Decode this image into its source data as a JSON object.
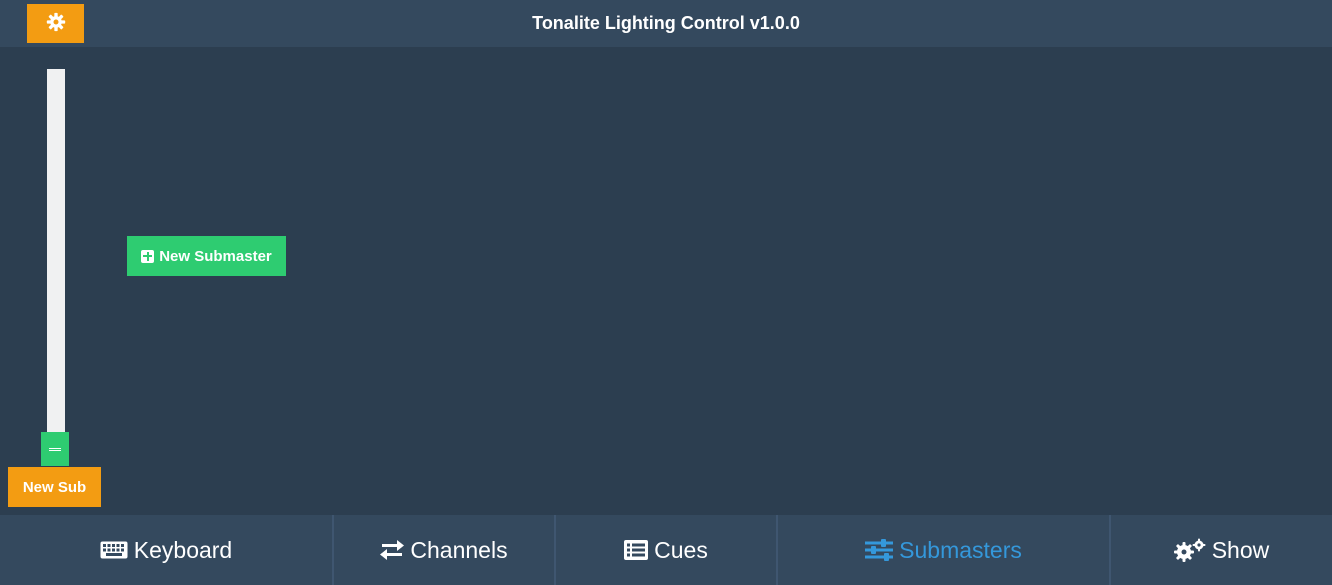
{
  "header": {
    "title": "Tonalite Lighting Control v1.0.0",
    "settings_icon": "gear-icon"
  },
  "colors": {
    "accent_orange": "#f39c12",
    "accent_green": "#2ecc71",
    "active_blue": "#3498db",
    "background": "#2c3e50",
    "bar": "#34495e"
  },
  "fader": {
    "level_percent": 0
  },
  "buttons": {
    "new_sub_label": "New Sub",
    "new_submaster_label": "New Submaster",
    "new_submaster_icon": "plus-square-icon"
  },
  "nav": {
    "items": [
      {
        "label": "Keyboard",
        "icon": "keyboard-icon",
        "active": false
      },
      {
        "label": "Channels",
        "icon": "exchange-icon",
        "active": false
      },
      {
        "label": "Cues",
        "icon": "list-icon",
        "active": false
      },
      {
        "label": "Submasters",
        "icon": "sliders-icon",
        "active": true
      },
      {
        "label": "Show",
        "icon": "cogs-icon",
        "active": false
      }
    ]
  }
}
